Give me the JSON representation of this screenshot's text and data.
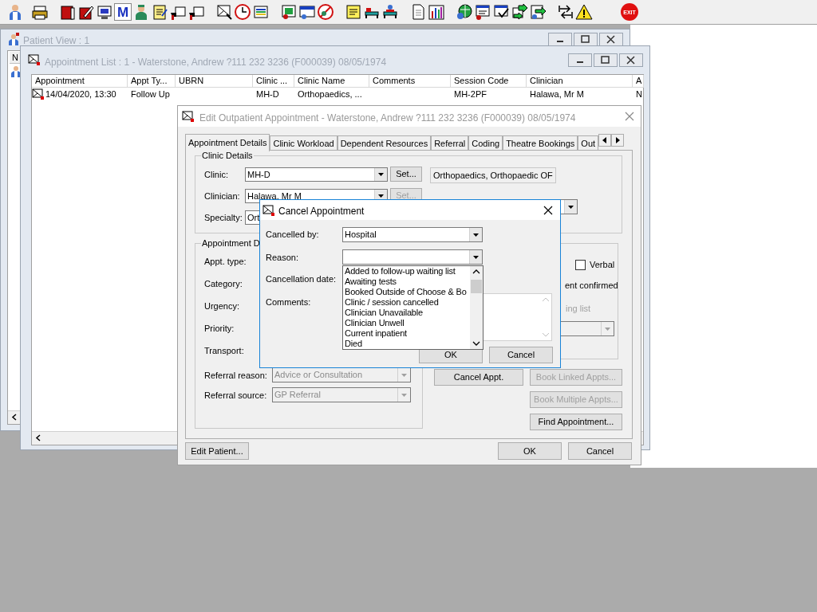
{
  "toolbar": {
    "letter_button": "M",
    "exit_button": "EXIT"
  },
  "patient_view": {
    "title": "Patient View : 1",
    "column_1": "N"
  },
  "appointment_list": {
    "title": "Appointment List : 1 - Waterstone, Andrew ?111 232 3236 (F000039) 08/05/1974",
    "columns": [
      "Appointment",
      "Appt Ty...",
      "UBRN",
      "Clinic ...",
      "Clinic Name",
      "Comments",
      "Session Code",
      "Clinician",
      "A"
    ],
    "rows": [
      {
        "cells": [
          "14/04/2020, 13:30",
          "Follow Up",
          "",
          "MH-D",
          "Orthopaedics, ...",
          "",
          "MH-2PF",
          "Halawa, Mr M",
          "N"
        ]
      }
    ]
  },
  "edit_dialog": {
    "title": "Edit Outpatient Appointment - Waterstone, Andrew ?111 232 3236 (F000039) 08/05/1974",
    "tabs": [
      {
        "label": "Appointment Details",
        "selected": true
      },
      {
        "label": "Clinic Workload",
        "selected": false
      },
      {
        "label": "Dependent Resources",
        "selected": false
      },
      {
        "label": "Referral",
        "selected": false
      },
      {
        "label": "Coding",
        "selected": false
      },
      {
        "label": "Theatre Bookings",
        "selected": false
      },
      {
        "label": "Out",
        "selected": false
      }
    ],
    "clinic_details": {
      "title": "Clinic Details",
      "rows": [
        {
          "label": "Clinic:",
          "value": "MH-D",
          "set_button": {
            "label": "Set...",
            "disabled": false
          },
          "description": "Orthopaedics, Orthopaedic OF"
        },
        {
          "label": "Clinician:",
          "value": "Halawa, Mr M",
          "set_button": {
            "label": "Set...",
            "disabled": true
          }
        },
        {
          "label": "Specialty:",
          "value": "Ort"
        }
      ]
    },
    "appointment_details": {
      "title": "Appointment D",
      "fields": [
        {
          "label": "Appt. type:"
        },
        {
          "label": "Category:"
        },
        {
          "label": "Urgency:"
        },
        {
          "label": "Priority:"
        },
        {
          "label": "Transport:"
        },
        {
          "label": "Referral reason:",
          "value": "Advice or Consultation",
          "disabled": true
        },
        {
          "label": "Referral source:",
          "value": "GP Referral",
          "disabled": true
        }
      ]
    },
    "status": {
      "verbal": {
        "label": "Verbal",
        "checked": false
      },
      "confirmed_label": "ent confirmed",
      "waiting_list_label": "ing list"
    },
    "action_buttons": [
      {
        "label": "Cancel Appt.",
        "disabled": false
      },
      {
        "label": "Book Linked Appts...",
        "disabled": true
      },
      {
        "label": "Book Multiple Appts...",
        "disabled": true
      },
      {
        "label": "Find Appointment...",
        "disabled": false
      }
    ],
    "footer": {
      "edit_patient": "Edit Patient...",
      "ok": "OK",
      "cancel": "Cancel"
    }
  },
  "cancel_dialog": {
    "title": "Cancel Appointment",
    "cancelled_by": {
      "label": "Cancelled by:",
      "value": "Hospital"
    },
    "reason": {
      "label": "Reason:",
      "options": [
        "Added to follow-up waiting list",
        "Awaiting tests",
        "Booked Outside of Choose & Bo",
        "Clinic / session cancelled",
        "Clinician Unavailable",
        "Clinician Unwell",
        "Current inpatient",
        "Died"
      ]
    },
    "cancellation_date": {
      "label": "Cancellation date:"
    },
    "comments": {
      "label": "Comments:"
    },
    "buttons": [
      "OK",
      "Cancel"
    ]
  }
}
